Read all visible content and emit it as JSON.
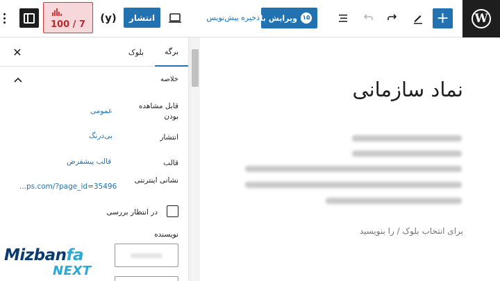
{
  "toolbar": {
    "view_post_label": "ویرایش با",
    "view_post_badge": "۱۵",
    "save_draft_label": "ذخیره پیش‌نویس",
    "publish_label": "انتشار",
    "yoast_label": "(y)",
    "seo_score": "100 / 7",
    "icons": [
      "wordpress-logo",
      "plus-icon",
      "pen-icon",
      "redo-icon",
      "undo-icon",
      "list-view-icon",
      "laptop-icon",
      "sidebar-icon",
      "more-options-icon"
    ]
  },
  "sidebar": {
    "tabs": [
      {
        "label": "برگه",
        "active": true
      },
      {
        "label": "بلوک",
        "active": false
      }
    ],
    "panel_title": "خلاصه",
    "rows": [
      {
        "label": "قابل مشاهده بودن",
        "value": "عمومی"
      },
      {
        "label": "انتشار",
        "value": "بی‌درنگ"
      },
      {
        "label": "قالب",
        "value": "قالب پیشفرض"
      },
      {
        "label": "نشانی اینترنتی",
        "value": "...ps.com/?page_id=35496"
      }
    ],
    "pending_review_label": "در انتظار بررسی",
    "pending_review_checked": false,
    "author_label": "نویسنده"
  },
  "watermark": {
    "part_a": "Mizban",
    "part_b": "fa",
    "part_c": "NEXT"
  },
  "editor": {
    "title": "نماد سازمانی",
    "block_placeholder": "برای انتخاب بلوک / را بنویسید"
  },
  "colors": {
    "accent": "#2271b1",
    "score_bg": "#f8d7da",
    "score_text": "#b32d2e",
    "dark": "#1e1e1e"
  }
}
